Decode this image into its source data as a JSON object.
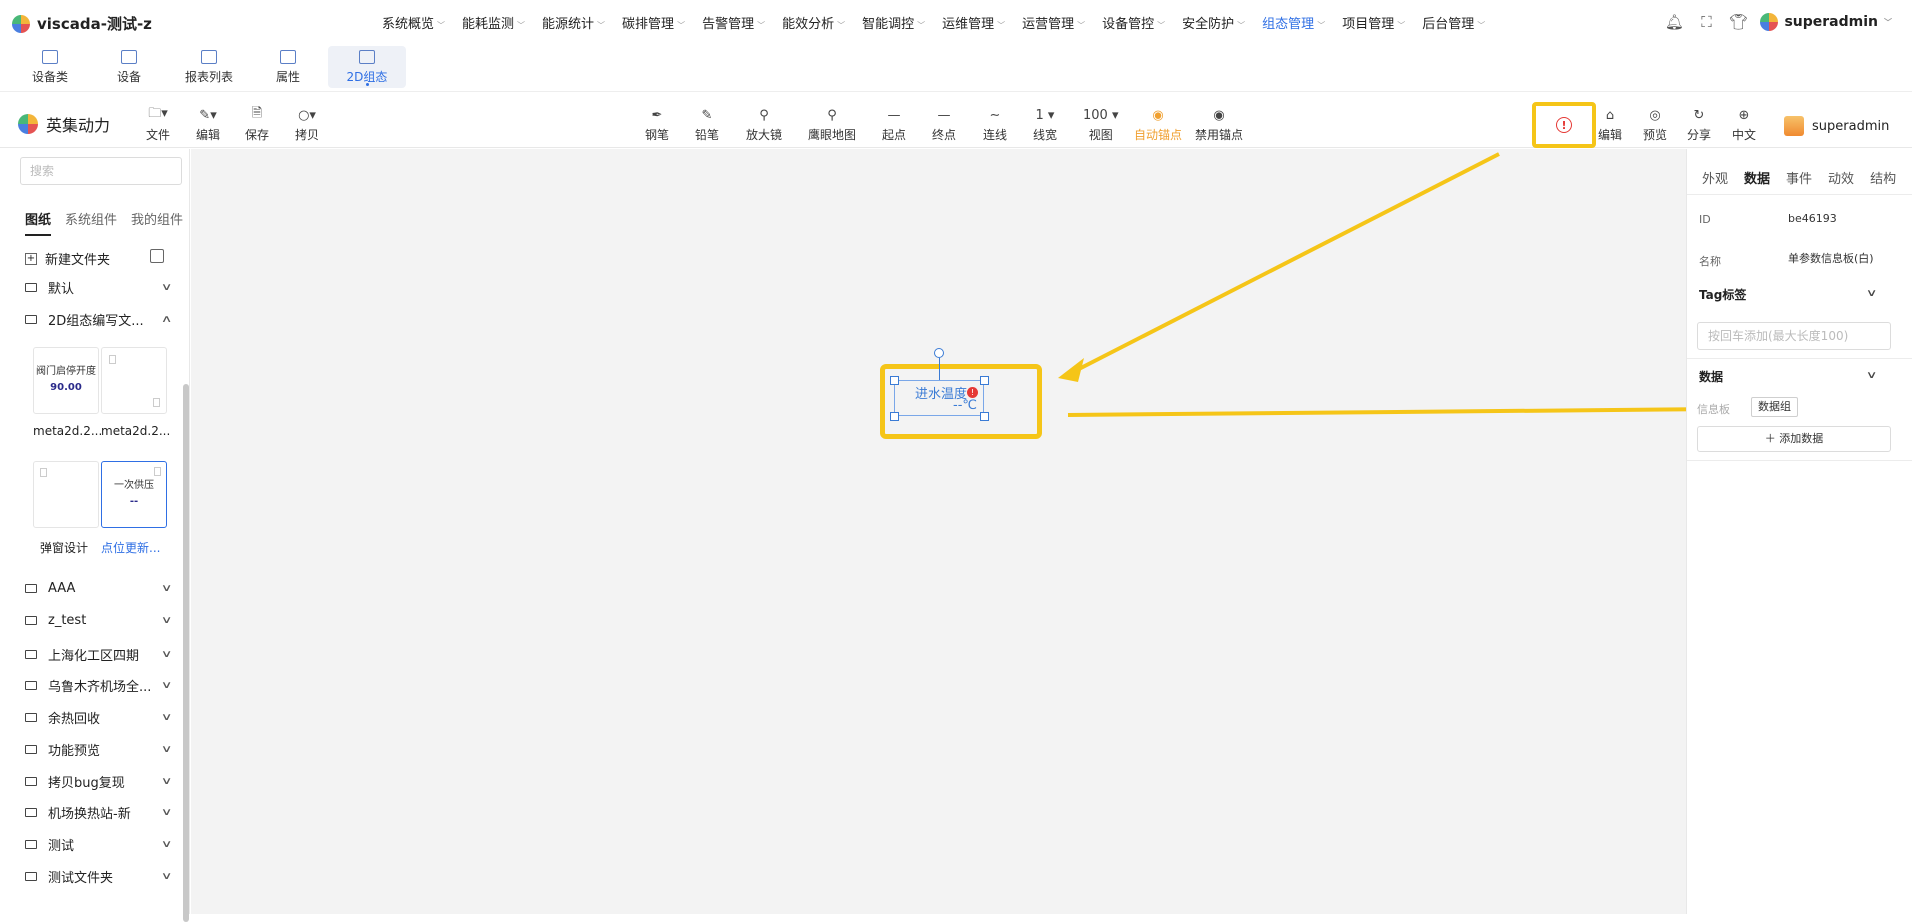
{
  "app": {
    "title": "viscada-测试-z"
  },
  "nav": {
    "items": [
      "系统概览",
      "能耗监测",
      "能源统计",
      "碳排管理",
      "告警管理",
      "能效分析",
      "智能调控",
      "运维管理",
      "运营管理",
      "设备管控",
      "安全防护",
      "组态管理",
      "项目管理",
      "后台管理"
    ],
    "active_index": 11,
    "user": "superadmin"
  },
  "subtabs": {
    "items": [
      "设备类",
      "设备",
      "报表列表",
      "属性",
      "2D组态"
    ],
    "active_index": 4
  },
  "editor": {
    "brand": "英集动力",
    "left_tools": [
      {
        "label": "文件",
        "icon": "file-icon"
      },
      {
        "label": "编辑",
        "icon": "edit-icon"
      },
      {
        "label": "保存",
        "icon": "save-icon"
      },
      {
        "label": "拷贝",
        "icon": "copy-icon"
      }
    ],
    "center_tools": [
      {
        "label": "钢笔",
        "icon": "pen-icon",
        "glyph": "✒"
      },
      {
        "label": "铅笔",
        "icon": "pencil-icon",
        "glyph": "✎"
      },
      {
        "label": "放大镜",
        "icon": "magnifier-icon",
        "glyph": "⚲"
      },
      {
        "label": "鹰眼地图",
        "icon": "map-pin-icon",
        "glyph": "⚲"
      },
      {
        "label": "起点",
        "icon": "start-line-icon",
        "glyph": "—"
      },
      {
        "label": "终点",
        "icon": "end-line-icon",
        "glyph": "—"
      },
      {
        "label": "连线",
        "icon": "curve-icon",
        "glyph": "∼"
      },
      {
        "label": "线宽",
        "icon": "line-width-icon",
        "glyph": "1 ▾"
      },
      {
        "label": "视图",
        "icon": "zoom-icon",
        "glyph": "100 ▾"
      },
      {
        "label": "自动锚点",
        "icon": "auto-anchor-icon",
        "glyph": "◉"
      },
      {
        "label": "禁用锚点",
        "icon": "disable-anchor-icon",
        "glyph": "◉"
      }
    ],
    "right_tools": [
      {
        "label": "编辑",
        "icon": "edit-icon",
        "glyph": "⌂"
      },
      {
        "label": "预览",
        "icon": "eye-icon",
        "glyph": "◎"
      },
      {
        "label": "分享",
        "icon": "share-icon",
        "glyph": "↻"
      },
      {
        "label": "中文",
        "icon": "globe-icon",
        "glyph": "⊕"
      }
    ],
    "alert_glyph": "!",
    "user": "superadmin"
  },
  "left_panel": {
    "search_placeholder": "搜索",
    "tabs": [
      "图纸",
      "系统组件",
      "我的组件"
    ],
    "new_folder": "新建文件夹",
    "folders_top": [
      "默认",
      "2D组态编写文..."
    ],
    "thumbnails": [
      {
        "title": "阀门启停开度",
        "value": "90.00",
        "caption": "meta2d.2..."
      },
      {
        "title": "",
        "value": "",
        "caption": "meta2d.2..."
      },
      {
        "title": "",
        "value": "",
        "caption": "弹窗设计"
      },
      {
        "title": "一次供压",
        "value": "--",
        "caption": "点位更新..."
      }
    ],
    "folders": [
      "AAA",
      "z_test",
      "上海化工区四期",
      "乌鲁木齐机场全...",
      "余热回收",
      "功能预览",
      "拷贝bug复现",
      "机场换热站-新",
      "测试",
      "测试文件夹"
    ]
  },
  "canvas": {
    "node": {
      "label": "进水温度",
      "value": "--℃",
      "error_glyph": "!"
    }
  },
  "right_panel": {
    "tabs": [
      "外观",
      "数据",
      "事件",
      "动效",
      "结构"
    ],
    "active_tab": 1,
    "id_label": "ID",
    "id_value": "be46193",
    "name_label": "名称",
    "name_value": "单参数信息板(白)",
    "tag_header": "Tag标签",
    "tag_placeholder": "按回车添加(最大长度100)",
    "data_header": "数据",
    "data_row_label": "信息板",
    "data_group_button": "数据组",
    "add_data_button": "添加数据"
  },
  "colors": {
    "accent": "#2f6fe4",
    "highlight": "#f5c518",
    "error": "#e53935",
    "orange": "#f0a030"
  }
}
